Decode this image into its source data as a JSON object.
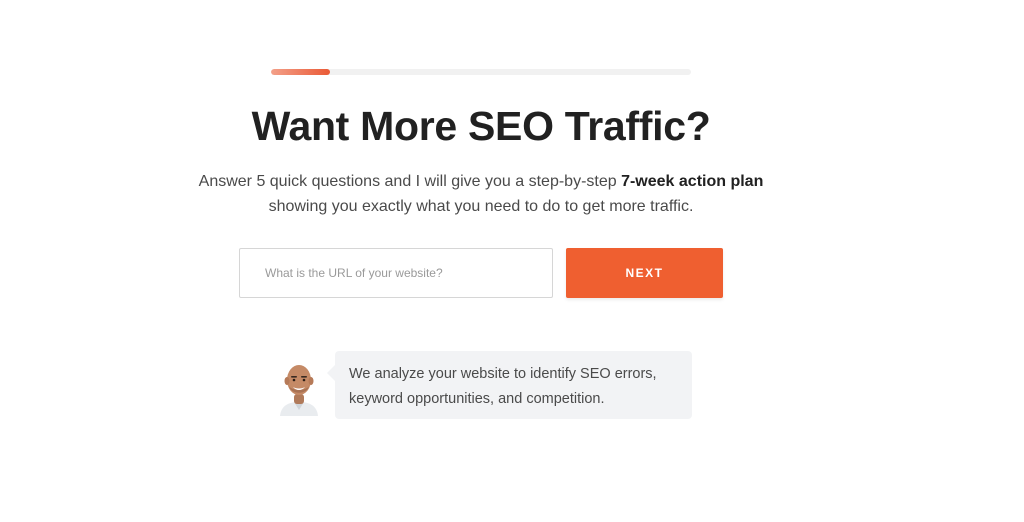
{
  "progress": {
    "fraction": 0.14,
    "fill_color": "#ea5a36",
    "track_color": "#f1f1f1"
  },
  "hero": {
    "title": "Want More SEO Traffic?",
    "subtitle_pre": "Answer 5 quick questions and I will give you a step-by-step ",
    "subtitle_bold": "7-week action plan",
    "subtitle_post": " showing you exactly what you need to do to get more traffic."
  },
  "form": {
    "url_placeholder": "What is the URL of your website?",
    "url_value": "",
    "next_label": "NEXT",
    "button_color": "#ef5f30"
  },
  "assistant": {
    "avatar_icon": "person-avatar-icon",
    "message_line1": "We analyze your website to identify SEO errors,",
    "message_line2": "keyword opportunities, and competition."
  }
}
